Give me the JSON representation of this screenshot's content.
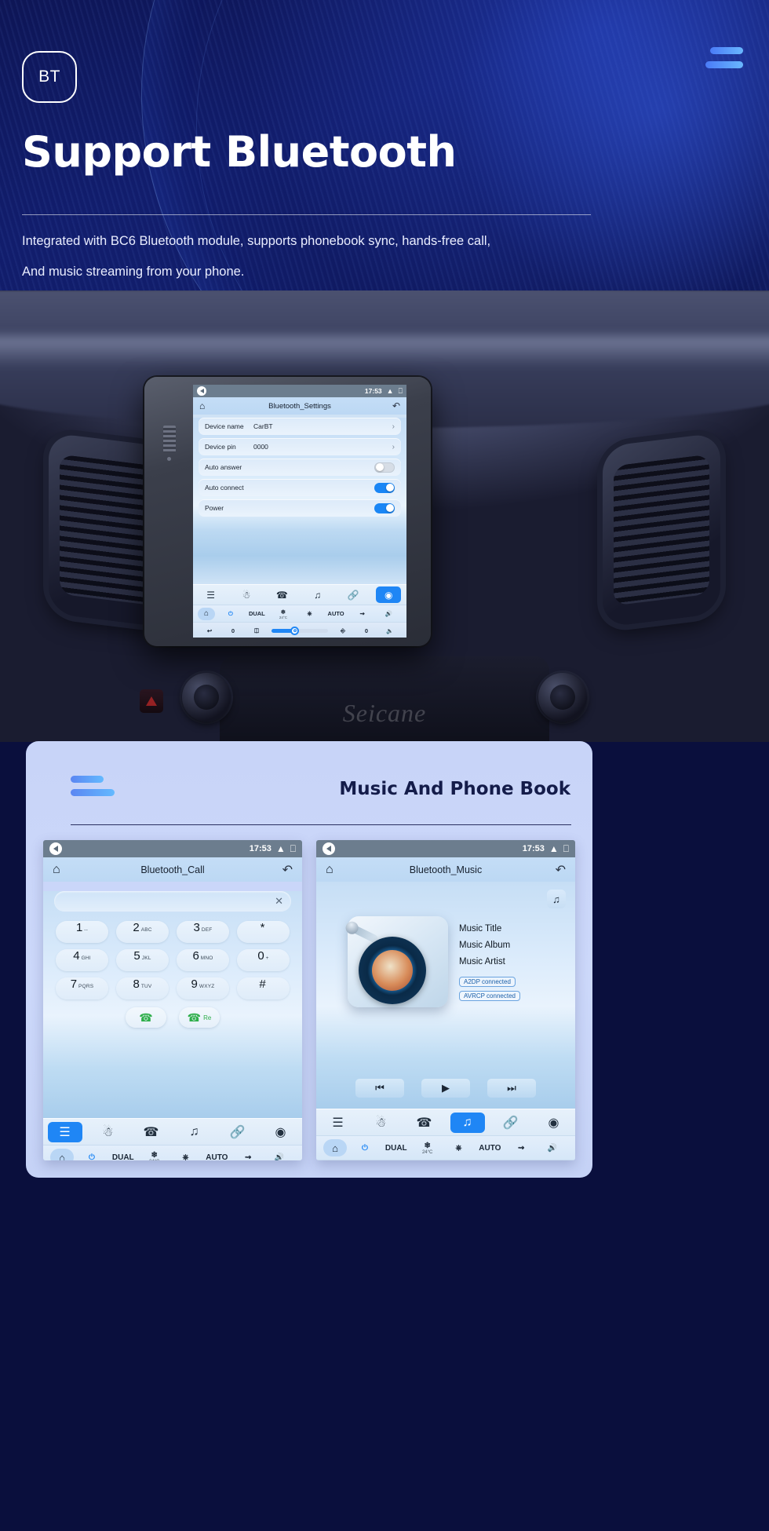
{
  "hero": {
    "badge": "BT",
    "title": "Support Bluetooth",
    "subtitle_line1": "Integrated with BC6 Bluetooth module, supports phonebook sync, hands-free call,",
    "subtitle_line2": "And music streaming from your phone.",
    "accent": "#4a7bf7"
  },
  "car": {
    "watermark": "Seicane"
  },
  "settings_screen": {
    "status": {
      "time": "17:53",
      "chevron_icon": "chevrons-up-icon",
      "window_icon": "window-icon"
    },
    "title": "Bluetooth_Settings",
    "home_icon": "home-icon",
    "return_icon": "return-icon",
    "rows": [
      {
        "label": "Device name",
        "value": "CarBT",
        "type": "chevron"
      },
      {
        "label": "Device pin",
        "value": "0000",
        "type": "chevron"
      },
      {
        "label": "Auto answer",
        "value": "",
        "type": "toggle",
        "on": false
      },
      {
        "label": "Auto connect",
        "value": "",
        "type": "toggle",
        "on": true
      },
      {
        "label": "Power",
        "value": "",
        "type": "toggle",
        "on": true
      }
    ],
    "dock": [
      {
        "icon": "dialpad-icon",
        "active": false
      },
      {
        "icon": "contact-icon",
        "active": false
      },
      {
        "icon": "phone-icon",
        "active": false
      },
      {
        "icon": "music-icon",
        "active": false
      },
      {
        "icon": "link-icon",
        "active": false
      },
      {
        "icon": "settings-icon",
        "active": true
      }
    ],
    "climate": {
      "home_icon": "home-icon",
      "power_icon": "power-icon",
      "dual": "DUAL",
      "snow_icon": "snowflake-icon",
      "temp": "24°C",
      "defrost_icon": "rear-defrost-icon",
      "auto": "AUTO",
      "airflow_icon": "airflow-icon",
      "vol_up_icon": "volume-up-icon",
      "back_icon": "back-arrow-icon",
      "left_value": "0",
      "seat_icon": "seat-icon",
      "seat_heat_icon": "seat-heat-icon",
      "right_value": "0",
      "vol_down_icon": "volume-down-icon",
      "fan_icon": "fan-icon"
    }
  },
  "card": {
    "title": "Music And Phone Book",
    "accent": "#5b86f2"
  },
  "call_screen": {
    "status": {
      "time": "17:53"
    },
    "title": "Bluetooth_Call",
    "home_icon": "home-icon",
    "return_icon": "return-icon",
    "search_value": "",
    "clear_icon": "clear-icon",
    "keys": [
      {
        "num": "1",
        "sub": "--"
      },
      {
        "num": "2",
        "sub": "ABC"
      },
      {
        "num": "3",
        "sub": "DEF"
      },
      {
        "num": "*",
        "sub": ""
      },
      {
        "num": "4",
        "sub": "GHI"
      },
      {
        "num": "5",
        "sub": "JKL"
      },
      {
        "num": "6",
        "sub": "MNO"
      },
      {
        "num": "0",
        "sub": "+"
      },
      {
        "num": "7",
        "sub": "PQRS"
      },
      {
        "num": "8",
        "sub": "TUV"
      },
      {
        "num": "9",
        "sub": "WXYZ"
      },
      {
        "num": "#",
        "sub": ""
      }
    ],
    "call_label": "",
    "redial_label": "Re",
    "dock": [
      {
        "icon": "dialpad-icon",
        "active": true
      },
      {
        "icon": "contact-icon",
        "active": false
      },
      {
        "icon": "phone-icon",
        "active": false
      },
      {
        "icon": "music-icon",
        "active": false
      },
      {
        "icon": "link-icon",
        "active": false
      },
      {
        "icon": "settings-icon",
        "active": false
      }
    ]
  },
  "music_screen": {
    "status": {
      "time": "17:53"
    },
    "title": "Bluetooth_Music",
    "home_icon": "home-icon",
    "return_icon": "return-icon",
    "music_toggle_icon": "music-note-icon",
    "track_title": "Music Title",
    "track_album": "Music Album",
    "track_artist": "Music Artist",
    "badge_a2dp": "A2DP  connected",
    "badge_avrcp": "AVRCP connected",
    "prev_icon": "previous-icon",
    "play_icon": "play-icon",
    "next_icon": "next-icon",
    "dock": [
      {
        "icon": "dialpad-icon",
        "active": false
      },
      {
        "icon": "contact-icon",
        "active": false
      },
      {
        "icon": "phone-icon",
        "active": false
      },
      {
        "icon": "music-icon",
        "active": true
      },
      {
        "icon": "link-icon",
        "active": false
      },
      {
        "icon": "settings-icon",
        "active": false
      }
    ]
  },
  "climate_common": {
    "dual": "DUAL",
    "auto": "AUTO",
    "temp": "24°C",
    "left_value": "0",
    "right_value": "0"
  }
}
